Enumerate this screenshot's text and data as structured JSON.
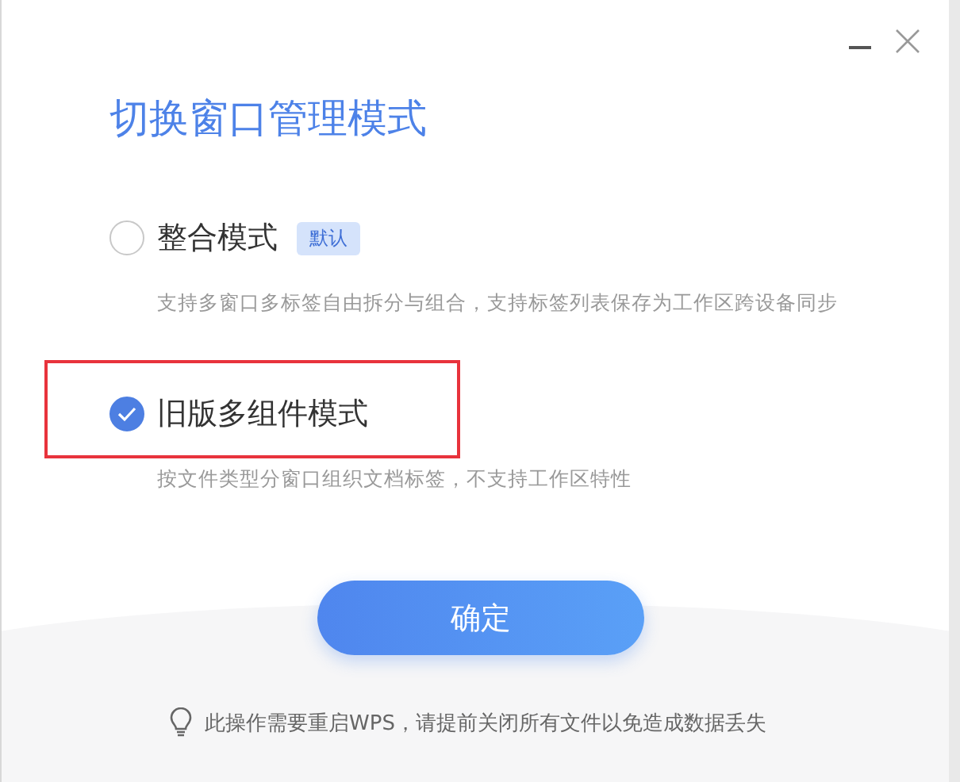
{
  "dialog": {
    "title": "切换窗口管理模式"
  },
  "options": [
    {
      "label": "整合模式",
      "badge": "默认",
      "description": "支持多窗口多标签自由拆分与组合，支持标签列表保存为工作区跨设备同步",
      "selected": false,
      "highlighted": false
    },
    {
      "label": "旧版多组件模式",
      "description": "按文件类型分窗口组织文档标签，不支持工作区特性",
      "selected": true,
      "highlighted": true
    }
  ],
  "confirm_button": "确定",
  "footer_note": "此操作需要重启WPS，请提前关闭所有文件以免造成数据丢失"
}
